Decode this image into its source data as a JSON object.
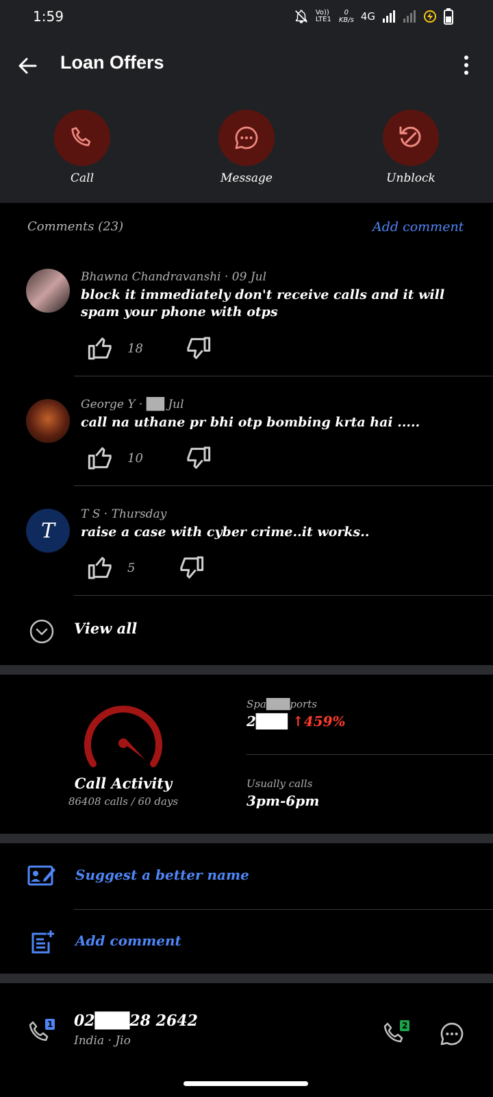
{
  "status_bar": {
    "time": "1:59",
    "network_speed": "0\nKB/s",
    "network_type": "4G",
    "volte_label": "Vo)) LTE1",
    "icons": [
      "mute-bell-icon",
      "volte-icon",
      "signal-icon",
      "signal-weak-icon",
      "battery-saver-icon",
      "battery-icon"
    ]
  },
  "appbar": {
    "title": "Loan Offers",
    "back_icon": "back-arrow-icon",
    "more_icon": "more-vert-icon"
  },
  "actions": [
    {
      "label": "Call",
      "icon": "phone-icon"
    },
    {
      "label": "Message",
      "icon": "chat-bubble-icon"
    },
    {
      "label": "Unblock",
      "icon": "unblock-icon"
    }
  ],
  "colors": {
    "accent_blue": "#4f86f7",
    "action_circle": "#5a1410",
    "action_icon": "#f08a80",
    "increase_red": "#ff3b30",
    "header_bg": "#202124"
  },
  "comments_section": {
    "title": "Comments (23)",
    "add_comment": "Add comment",
    "view_all": "View all"
  },
  "comments": [
    {
      "author": "Bhawna Chandravanshi",
      "date": "09 Jul",
      "meta": "Bhawna Chandravanshi · 09 Jul",
      "text": "block it immediately don't receive calls and it will spam your phone with otps",
      "likes": "18"
    },
    {
      "author": "George Y",
      "date": "Jul",
      "meta": "George Y · ██ Jul",
      "text": "call na uthane pr bhi otp bombing krta hai .....",
      "likes": "10"
    },
    {
      "author": "T S",
      "date": "Thursday",
      "meta": "T S · Thursday",
      "avatar_letter": "T",
      "text": "raise a case with cyber crime..it works..",
      "likes": "5"
    }
  ],
  "activity": {
    "title": "Call Activity",
    "subtitle": "86408 calls / 60 days",
    "spam_reports_label": "Spa███ports",
    "spam_reports_value": "2███",
    "spam_change": "↑459%",
    "usually_calls_label": "Usually calls",
    "usually_calls_value": "3pm-6pm"
  },
  "links": {
    "suggest_name": "Suggest a better name",
    "add_comment": "Add comment"
  },
  "number_row": {
    "number": "02███28 2642",
    "carrier": "India · Jio",
    "sim1_badge": "1",
    "sim2_badge": "2"
  }
}
